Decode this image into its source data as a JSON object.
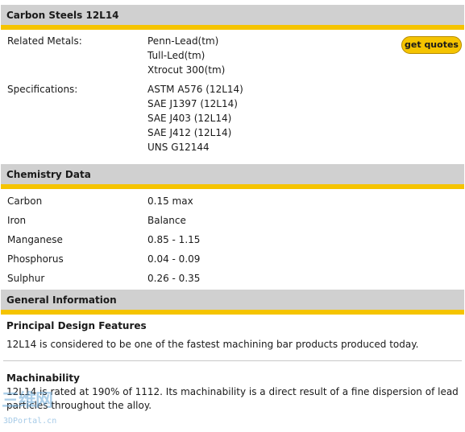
{
  "header": {
    "title": "Carbon Steels 12L14"
  },
  "actions": {
    "get_quotes": "get quotes"
  },
  "related": {
    "label": "Related Metals:",
    "values": [
      "Penn-Lead(tm)",
      "Tull-Led(tm)",
      "Xtrocut 300(tm)"
    ]
  },
  "specs": {
    "label": "Specifications:",
    "values": [
      "ASTM A576 (12L14)",
      "SAE J1397 (12L14)",
      "SAE J403 (12L14)",
      "SAE J412 (12L14)",
      "UNS G12144"
    ]
  },
  "chemistry": {
    "title": "Chemistry Data",
    "rows": [
      {
        "element": "Carbon",
        "value": "0.15 max"
      },
      {
        "element": "Iron",
        "value": "Balance"
      },
      {
        "element": "Manganese",
        "value": "0.85 - 1.15"
      },
      {
        "element": "Phosphorus",
        "value": "0.04 - 0.09"
      },
      {
        "element": "Sulphur",
        "value": "0.26 - 0.35"
      }
    ]
  },
  "general": {
    "title": "General Information",
    "design_title": "Principal Design Features",
    "design_text": "12L14 is considered to be one of the fastest machining bar products produced today.",
    "mach_title": "Machinability",
    "mach_text_1": "12L14 is rated at 190% of 1112. Its machinability is a direct result of a fine dispersion of lead",
    "mach_text_2": "particles throughout the alloy."
  },
  "watermark": {
    "main": "三维网",
    "sub": "3DPortal.cn"
  }
}
